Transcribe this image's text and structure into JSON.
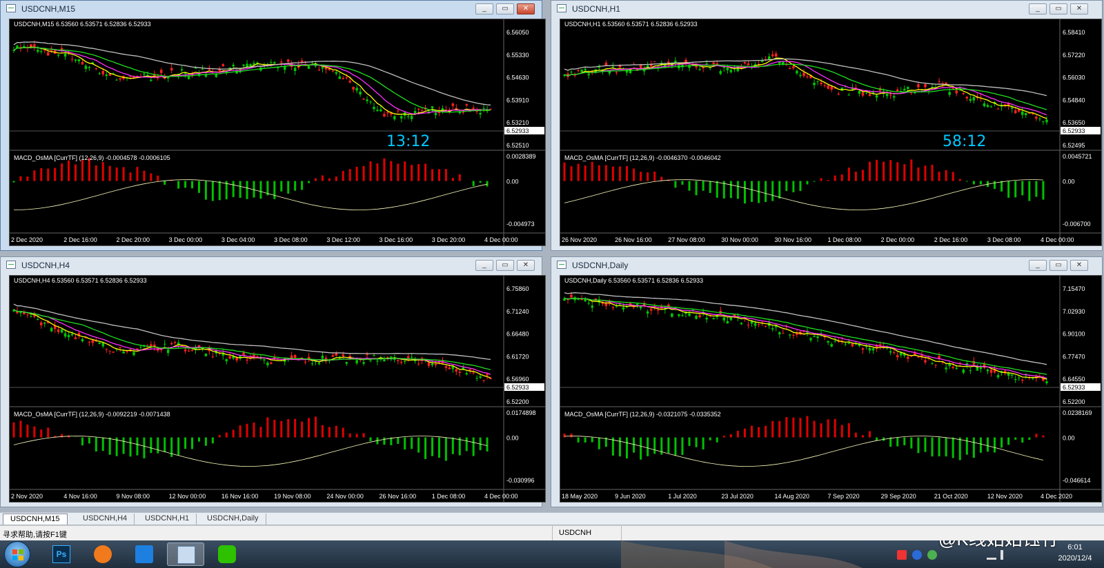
{
  "windows": [
    {
      "key": "m15",
      "title": "USDCNH,M15",
      "info": "USDCNH,M15  6.53560 6.53571 6.52836 6.52933",
      "macd_info": "MACD_OsMA [CurrTF] (12,26,9) -0.0004578 -0.0006105",
      "prices": [
        "6.56050",
        "6.55330",
        "6.54630",
        "6.53910",
        "6.53210",
        "6.52510"
      ],
      "current": "6.52933",
      "macd_scale": [
        "0.0028389",
        "0.00",
        "-0.004973"
      ],
      "dates": [
        "2 Dec 2020",
        "2 Dec 16:00",
        "2 Dec 20:00",
        "3 Dec 00:00",
        "3 Dec 04:00",
        "3 Dec 08:00",
        "3 Dec 12:00",
        "3 Dec 16:00",
        "3 Dec 20:00",
        "4 Dec 00:00"
      ],
      "timer": "13:12",
      "active": true
    },
    {
      "key": "h1",
      "title": "USDCNH,H1",
      "info": "USDCNH,H1  6.53560 6.53571 6.52836 6.52933",
      "macd_info": "MACD_OsMA [CurrTF] (12,26,9) -0.0046370 -0.0046042",
      "prices": [
        "6.58410",
        "6.57220",
        "6.56030",
        "6.54840",
        "6.53650",
        "6.52495"
      ],
      "current": "6.52933",
      "macd_scale": [
        "0.0045721",
        "0.00",
        "-0.006700"
      ],
      "dates": [
        "26 Nov 2020",
        "26 Nov 16:00",
        "27 Nov 08:00",
        "30 Nov 00:00",
        "30 Nov 16:00",
        "1 Dec 08:00",
        "2 Dec 00:00",
        "2 Dec 16:00",
        "3 Dec 08:00",
        "4 Dec 00:00"
      ],
      "timer": "58:12",
      "active": false
    },
    {
      "key": "h4",
      "title": "USDCNH,H4",
      "info": "USDCNH,H4  6.53560 6.53571 6.52836 6.52933",
      "macd_info": "MACD_OsMA [CurrTF] (12,26,9) -0.0092219 -0.0071438",
      "prices": [
        "6.75860",
        "6.71240",
        "6.66480",
        "6.61720",
        "6.56960",
        "6.52200"
      ],
      "current": "6.52933",
      "macd_scale": [
        "0.0174898",
        "0.00",
        "-0.030996"
      ],
      "dates": [
        "2 Nov 2020",
        "4 Nov 16:00",
        "9 Nov 08:00",
        "12 Nov 00:00",
        "16 Nov 16:00",
        "19 Nov 08:00",
        "24 Nov 00:00",
        "26 Nov 16:00",
        "1 Dec 08:00",
        "4 Dec 00:00"
      ],
      "timer": "",
      "active": false
    },
    {
      "key": "d1",
      "title": "USDCNH,Daily",
      "info": "USDCNH,Daily  6.53560 6.53571 6.52836 6.52933",
      "macd_info": "MACD_OsMA [CurrTF] (12,26,9) -0.0321075 -0.0335352",
      "prices": [
        "7.15470",
        "7.02930",
        "6.90100",
        "6.77470",
        "6.64550",
        "6.52200"
      ],
      "current": "6.52933",
      "macd_scale": [
        "0.0238169",
        "0.00",
        "-0.046614"
      ],
      "dates": [
        "18 May 2020",
        "9 Jun 2020",
        "1 Jul 2020",
        "23 Jul 2020",
        "14 Aug 2020",
        "7 Sep 2020",
        "29 Sep 2020",
        "21 Oct 2020",
        "12 Nov 2020",
        "4 Dec 2020"
      ],
      "timer": "",
      "active": false
    }
  ],
  "tabs": [
    "USDCNH,M15",
    "USDCNH,H4",
    "USDCNH,H1",
    "USDCNH,Daily"
  ],
  "status": {
    "help": "寻求帮助,请按F1键",
    "symbol": "USDCNH"
  },
  "taskbar": {
    "time": "6:01",
    "date": "2020/12/4",
    "watermark": "@K线姑姑钰竹"
  },
  "colors": {
    "bull": "#00c800",
    "bear": "#ff2020",
    "ma_fast": "#ffff00",
    "ma_mid": "#ff30ff",
    "ma_slow": "#20e020",
    "ma_long": "#c0c0c0",
    "macd_pos": "#e00000",
    "macd_neg": "#00c000",
    "timer": "#00c8ff"
  }
}
